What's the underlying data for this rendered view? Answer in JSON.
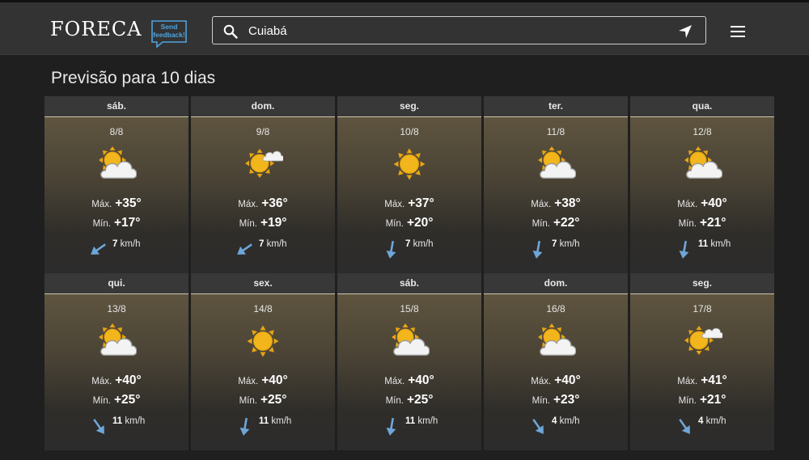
{
  "header": {
    "logo": "FORECA",
    "feedback_line1": "Send",
    "feedback_line2": "feedback!",
    "search_value": "Cuiabá",
    "search_icon": "search-icon",
    "location_icon": "location-arrow-icon",
    "menu_icon": "hamburger-menu-icon"
  },
  "page_title": "Previsão para 10 dias",
  "labels": {
    "max": "Máx.",
    "min": "Mín.",
    "unit": "km/h"
  },
  "days": [
    {
      "name": "sáb.",
      "date": "8/8",
      "icon": "partly-cloudy-icon",
      "max": "+35°",
      "min": "+17°",
      "wind": "7",
      "wind_dir_deg": 235
    },
    {
      "name": "dom.",
      "date": "9/8",
      "icon": "mostly-sunny-icon",
      "max": "+36°",
      "min": "+19°",
      "wind": "7",
      "wind_dir_deg": 235
    },
    {
      "name": "seg.",
      "date": "10/8",
      "icon": "sunny-icon",
      "max": "+37°",
      "min": "+20°",
      "wind": "7",
      "wind_dir_deg": 190
    },
    {
      "name": "ter.",
      "date": "11/8",
      "icon": "partly-cloudy-icon",
      "max": "+38°",
      "min": "+22°",
      "wind": "7",
      "wind_dir_deg": 190
    },
    {
      "name": "qua.",
      "date": "12/8",
      "icon": "partly-cloudy-icon",
      "max": "+40°",
      "min": "+21°",
      "wind": "11",
      "wind_dir_deg": 190
    },
    {
      "name": "qui.",
      "date": "13/8",
      "icon": "partly-cloudy-icon",
      "max": "+40°",
      "min": "+25°",
      "wind": "11",
      "wind_dir_deg": 145
    },
    {
      "name": "sex.",
      "date": "14/8",
      "icon": "sunny-icon",
      "max": "+40°",
      "min": "+25°",
      "wind": "11",
      "wind_dir_deg": 190
    },
    {
      "name": "sáb.",
      "date": "15/8",
      "icon": "partly-cloudy-icon",
      "max": "+40°",
      "min": "+25°",
      "wind": "11",
      "wind_dir_deg": 190
    },
    {
      "name": "dom.",
      "date": "16/8",
      "icon": "partly-cloudy-icon",
      "max": "+40°",
      "min": "+23°",
      "wind": "4",
      "wind_dir_deg": 145
    },
    {
      "name": "seg.",
      "date": "17/8",
      "icon": "mostly-sunny-icon",
      "max": "+41°",
      "min": "+21°",
      "wind": "4",
      "wind_dir_deg": 145
    }
  ],
  "colors": {
    "sun": "#f2b61c",
    "sun_ray": "#e8a514",
    "cloud": "#f3f3f3",
    "arrow": "#6ea6d8",
    "feedback": "#4fa3e0"
  }
}
